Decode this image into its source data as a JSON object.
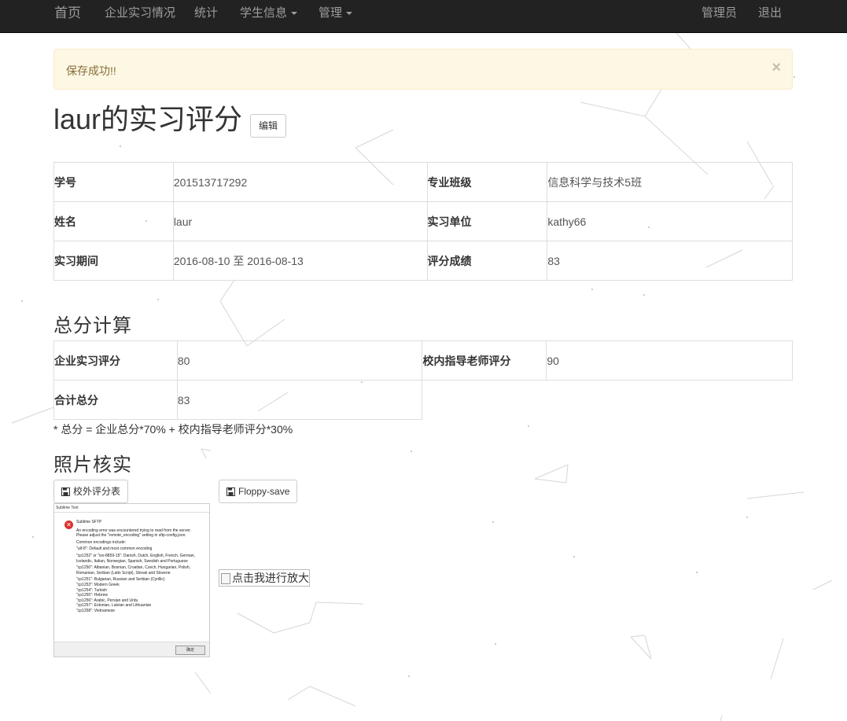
{
  "nav": {
    "home": "首页",
    "internship": "企业实习情况",
    "stats": "统计",
    "student_info": "学生信息",
    "manage": "管理",
    "admin": "管理员",
    "logout": "退出"
  },
  "alert": {
    "message": "保存成功!!",
    "close": "×"
  },
  "title": {
    "text": "laur的实习评分",
    "edit_button": "编辑"
  },
  "info_table": {
    "rows": [
      {
        "l1": "学号",
        "v1": "201513717292",
        "l2": "专业班级",
        "v2": "信息科学与技术5班"
      },
      {
        "l1": "姓名",
        "v1": "laur",
        "l2": "实习单位",
        "v2": "kathy66"
      },
      {
        "l1": "实习期间",
        "v1": "2016-08-10 至 2016-08-13",
        "l2": "评分成绩",
        "v2": "83"
      }
    ]
  },
  "score_section": {
    "heading": "总分计算",
    "enterprise_label": "企业实习评分",
    "enterprise_value": "80",
    "teacher_label": "校内指导老师评分",
    "teacher_value": "90",
    "total_label": "合计总分",
    "total_value": "83",
    "note": "*  总分 = 企业总分*70% + 校内指导老师评分*30%"
  },
  "photo_section": {
    "heading": "照片核实",
    "btn_external": "校外评分表",
    "btn_floppy": "Floppy-save",
    "broken_image_alt": "点击我进行放大",
    "thumb": {
      "window_title": "Sublime Text",
      "heading": "Sublime SFTP",
      "lines": [
        "An encoding error was encountered trying to read from the server.",
        "Please adjust the \"remote_encoding\" setting in sftp-config.json.",
        "",
        "Common encodings include:",
        "",
        "\"utf-8\": Default and most common encoding",
        "",
        "\"cp1252\" or \"iso-8859-15\": Danish, Dutch, English, French, German,",
        "Icelandic, Italian, Norwegian, Spanish, Swedish and Portuguese",
        "",
        "\"cp1250\": Albanian, Bosnian, Croatian, Czech, Hungarian, Polish,",
        "Romanian, Serbian (Latin Script), Slovak and Slovene",
        "",
        "\"cp1251\": Bulgarian, Russian and Serbian (Cyrillic)",
        "\"cp1253\": Modern Greek",
        "\"cp1254\": Turkish",
        "\"cp1255\": Hebrew",
        "\"cp1256\": Arabic, Persian and Urdu",
        "\"cp1257\": Estonian, Latvian and Lithuanian",
        "\"cp1258\": Vietnamese"
      ],
      "ok_button": "确定"
    }
  },
  "colors": {
    "navbar": "#222222",
    "nav_text": "#9d9d9d",
    "alert_bg": "#fcf8e3",
    "alert_border": "#faebcc",
    "alert_text": "#8a6d3b",
    "table_border": "#dddddd"
  },
  "icons": {
    "external_button": "floppy-save-icon",
    "floppy_button": "floppy-save-icon",
    "alert_close": "close-icon",
    "thumb_error": "error-icon"
  }
}
